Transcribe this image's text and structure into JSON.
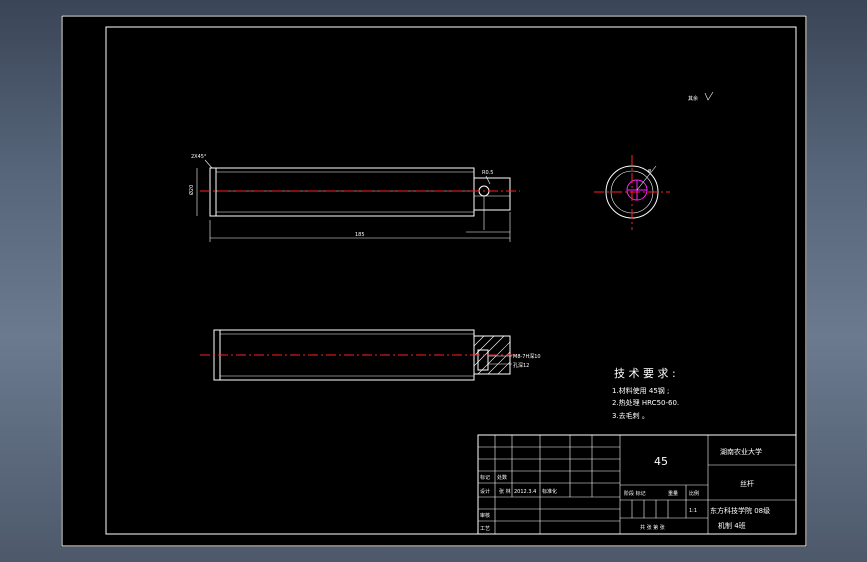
{
  "drawing": {
    "roughness_note": "其余",
    "chamfer": "2X45°",
    "diameter_dim": "Ø20",
    "length_dim": "185",
    "small_radius": "R0.5",
    "thread_note_1": "M8-7H深10",
    "thread_note_2": "孔深12"
  },
  "tech_requirements": {
    "title": "技 术 要 求 :",
    "items": [
      "1.材料使用 45钢 ;",
      "2.热处理 HRC50-60.",
      "3.去毛刺 。"
    ]
  },
  "title_block": {
    "material": "45",
    "university": "湖南农业大学",
    "part_name": "丝杆",
    "college_line1": "东方科技学院 08级",
    "college_line2": "机制 4班",
    "scale": "1:1",
    "label_mark": "标记",
    "label_count": "处数",
    "label_design": "设计",
    "label_name": "张 林",
    "label_date": "2012.3.4",
    "label_standard": "标准化",
    "label_review": "审核",
    "label_process": "工艺",
    "label_stage": "阶段 标记",
    "label_weight": "重量",
    "label_ratio": "比例",
    "label_sheets": "共 张  第 张"
  }
}
